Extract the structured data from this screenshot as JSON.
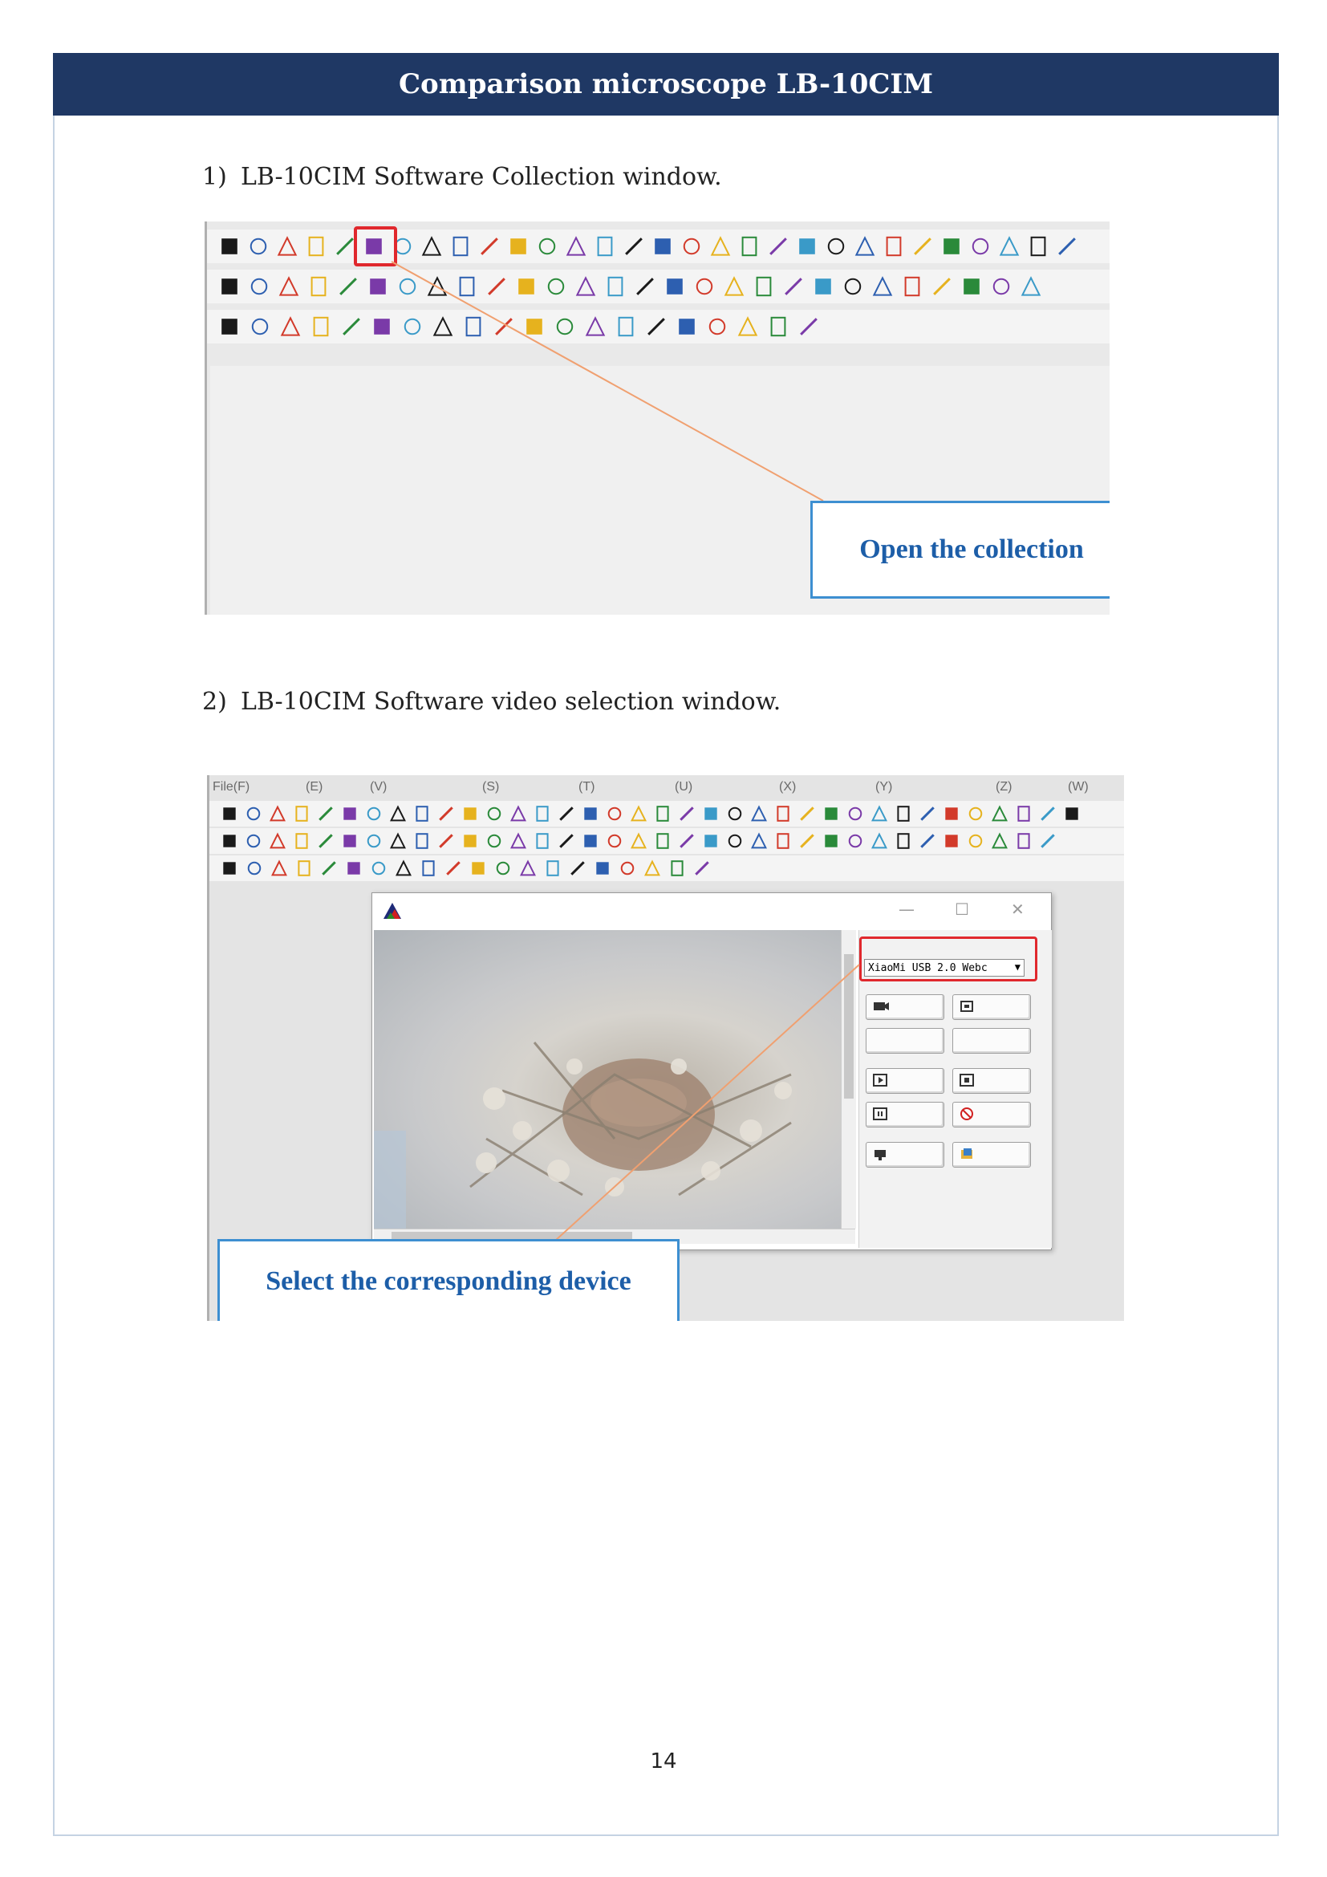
{
  "header": {
    "title": "Comparison microscope LB-10CIM"
  },
  "sections": [
    {
      "number": "1)",
      "caption": "LB-10CIM Software Collection window.",
      "callout": "Open the collection"
    },
    {
      "number": "2)",
      "caption": "LB-10CIM Software video selection window.",
      "callout": "Select the corresponding device"
    }
  ],
  "menu": [
    "File(F)",
    "(E)",
    "(V)",
    "(S)",
    "(T)",
    "(U)",
    "(X)",
    "(Y)",
    "(Z)",
    "(W)"
  ],
  "capture_window": {
    "device_value": "XiaoMi USB 2.0 Webc",
    "controls": [
      "minimize",
      "maximize",
      "close"
    ]
  },
  "colors": {
    "header_bg": "#1f3864",
    "callout_border": "#3d8fd1",
    "callout_text": "#1d5ea8",
    "highlight": "#e0282d"
  },
  "footer": {
    "page_number": "14"
  }
}
